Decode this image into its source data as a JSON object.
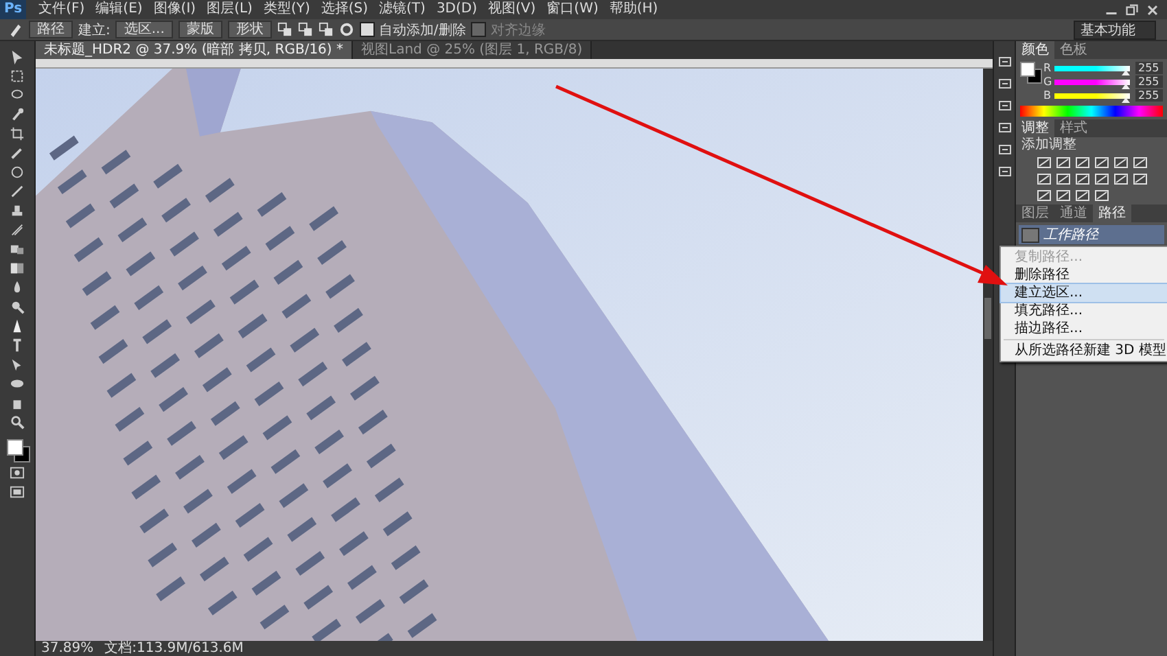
{
  "app": {
    "logo": "Ps"
  },
  "menu": [
    "文件(F)",
    "编辑(E)",
    "图像(I)",
    "图层(L)",
    "类型(Y)",
    "选择(S)",
    "滤镜(T)",
    "3D(D)",
    "视图(V)",
    "窗口(W)",
    "帮助(H)"
  ],
  "options_bar": {
    "mode": "路径",
    "make_label": "建立:",
    "selection_button": "选区...",
    "mask_button": "蒙版",
    "shape_button": "形状",
    "auto_add_delete": {
      "label": "自动添加/删除",
      "checked": true
    },
    "align_edges": {
      "label": "对齐边缘",
      "checked": false,
      "disabled": true
    }
  },
  "workspace": "基本功能",
  "document_tabs": [
    {
      "title": "未标题_HDR2 @ 37.9% (暗部 拷贝, RGB/16) *",
      "selected": true
    },
    {
      "title": "视图Land @ 25% (图层 1, RGB/8)",
      "selected": false
    }
  ],
  "color_panel": {
    "tabs": [
      {
        "label": "颜色",
        "selected": true
      },
      {
        "label": "色板",
        "selected": false
      }
    ],
    "sliders": [
      {
        "name": "R",
        "value": "255",
        "level": 1,
        "color": "#00ffff"
      },
      {
        "name": "G",
        "value": "255",
        "level": 1,
        "color": "#ff00ff"
      },
      {
        "name": "B",
        "value": "255",
        "level": 1,
        "color": "#ffff00"
      }
    ]
  },
  "adjustments_panel": {
    "tabs": [
      {
        "label": "调整",
        "selected": true
      },
      {
        "label": "样式",
        "selected": false
      }
    ],
    "heading": "添加调整"
  },
  "layers_panel": {
    "tabs": [
      {
        "label": "图层",
        "selected": false
      },
      {
        "label": "通道",
        "selected": false
      },
      {
        "label": "路径",
        "selected": true
      }
    ],
    "paths": [
      {
        "name": "工作路径",
        "selected": true
      }
    ]
  },
  "context_menu": [
    {
      "label": "复制路径...",
      "disabled": true,
      "selected": false
    },
    {
      "label": "删除路径",
      "disabled": false,
      "selected": false
    },
    {
      "label": "建立选区...",
      "disabled": false,
      "selected": true
    },
    {
      "label": "填充路径...",
      "disabled": false,
      "selected": false
    },
    {
      "label": "描边路径...",
      "disabled": false,
      "selected": false
    },
    {
      "label": "从所选路径新建 3D 模型",
      "disabled": false,
      "selected": false
    }
  ],
  "status_bar": {
    "zoom": "37.89%",
    "doc_info": "文档:113.9M/613.6M"
  }
}
